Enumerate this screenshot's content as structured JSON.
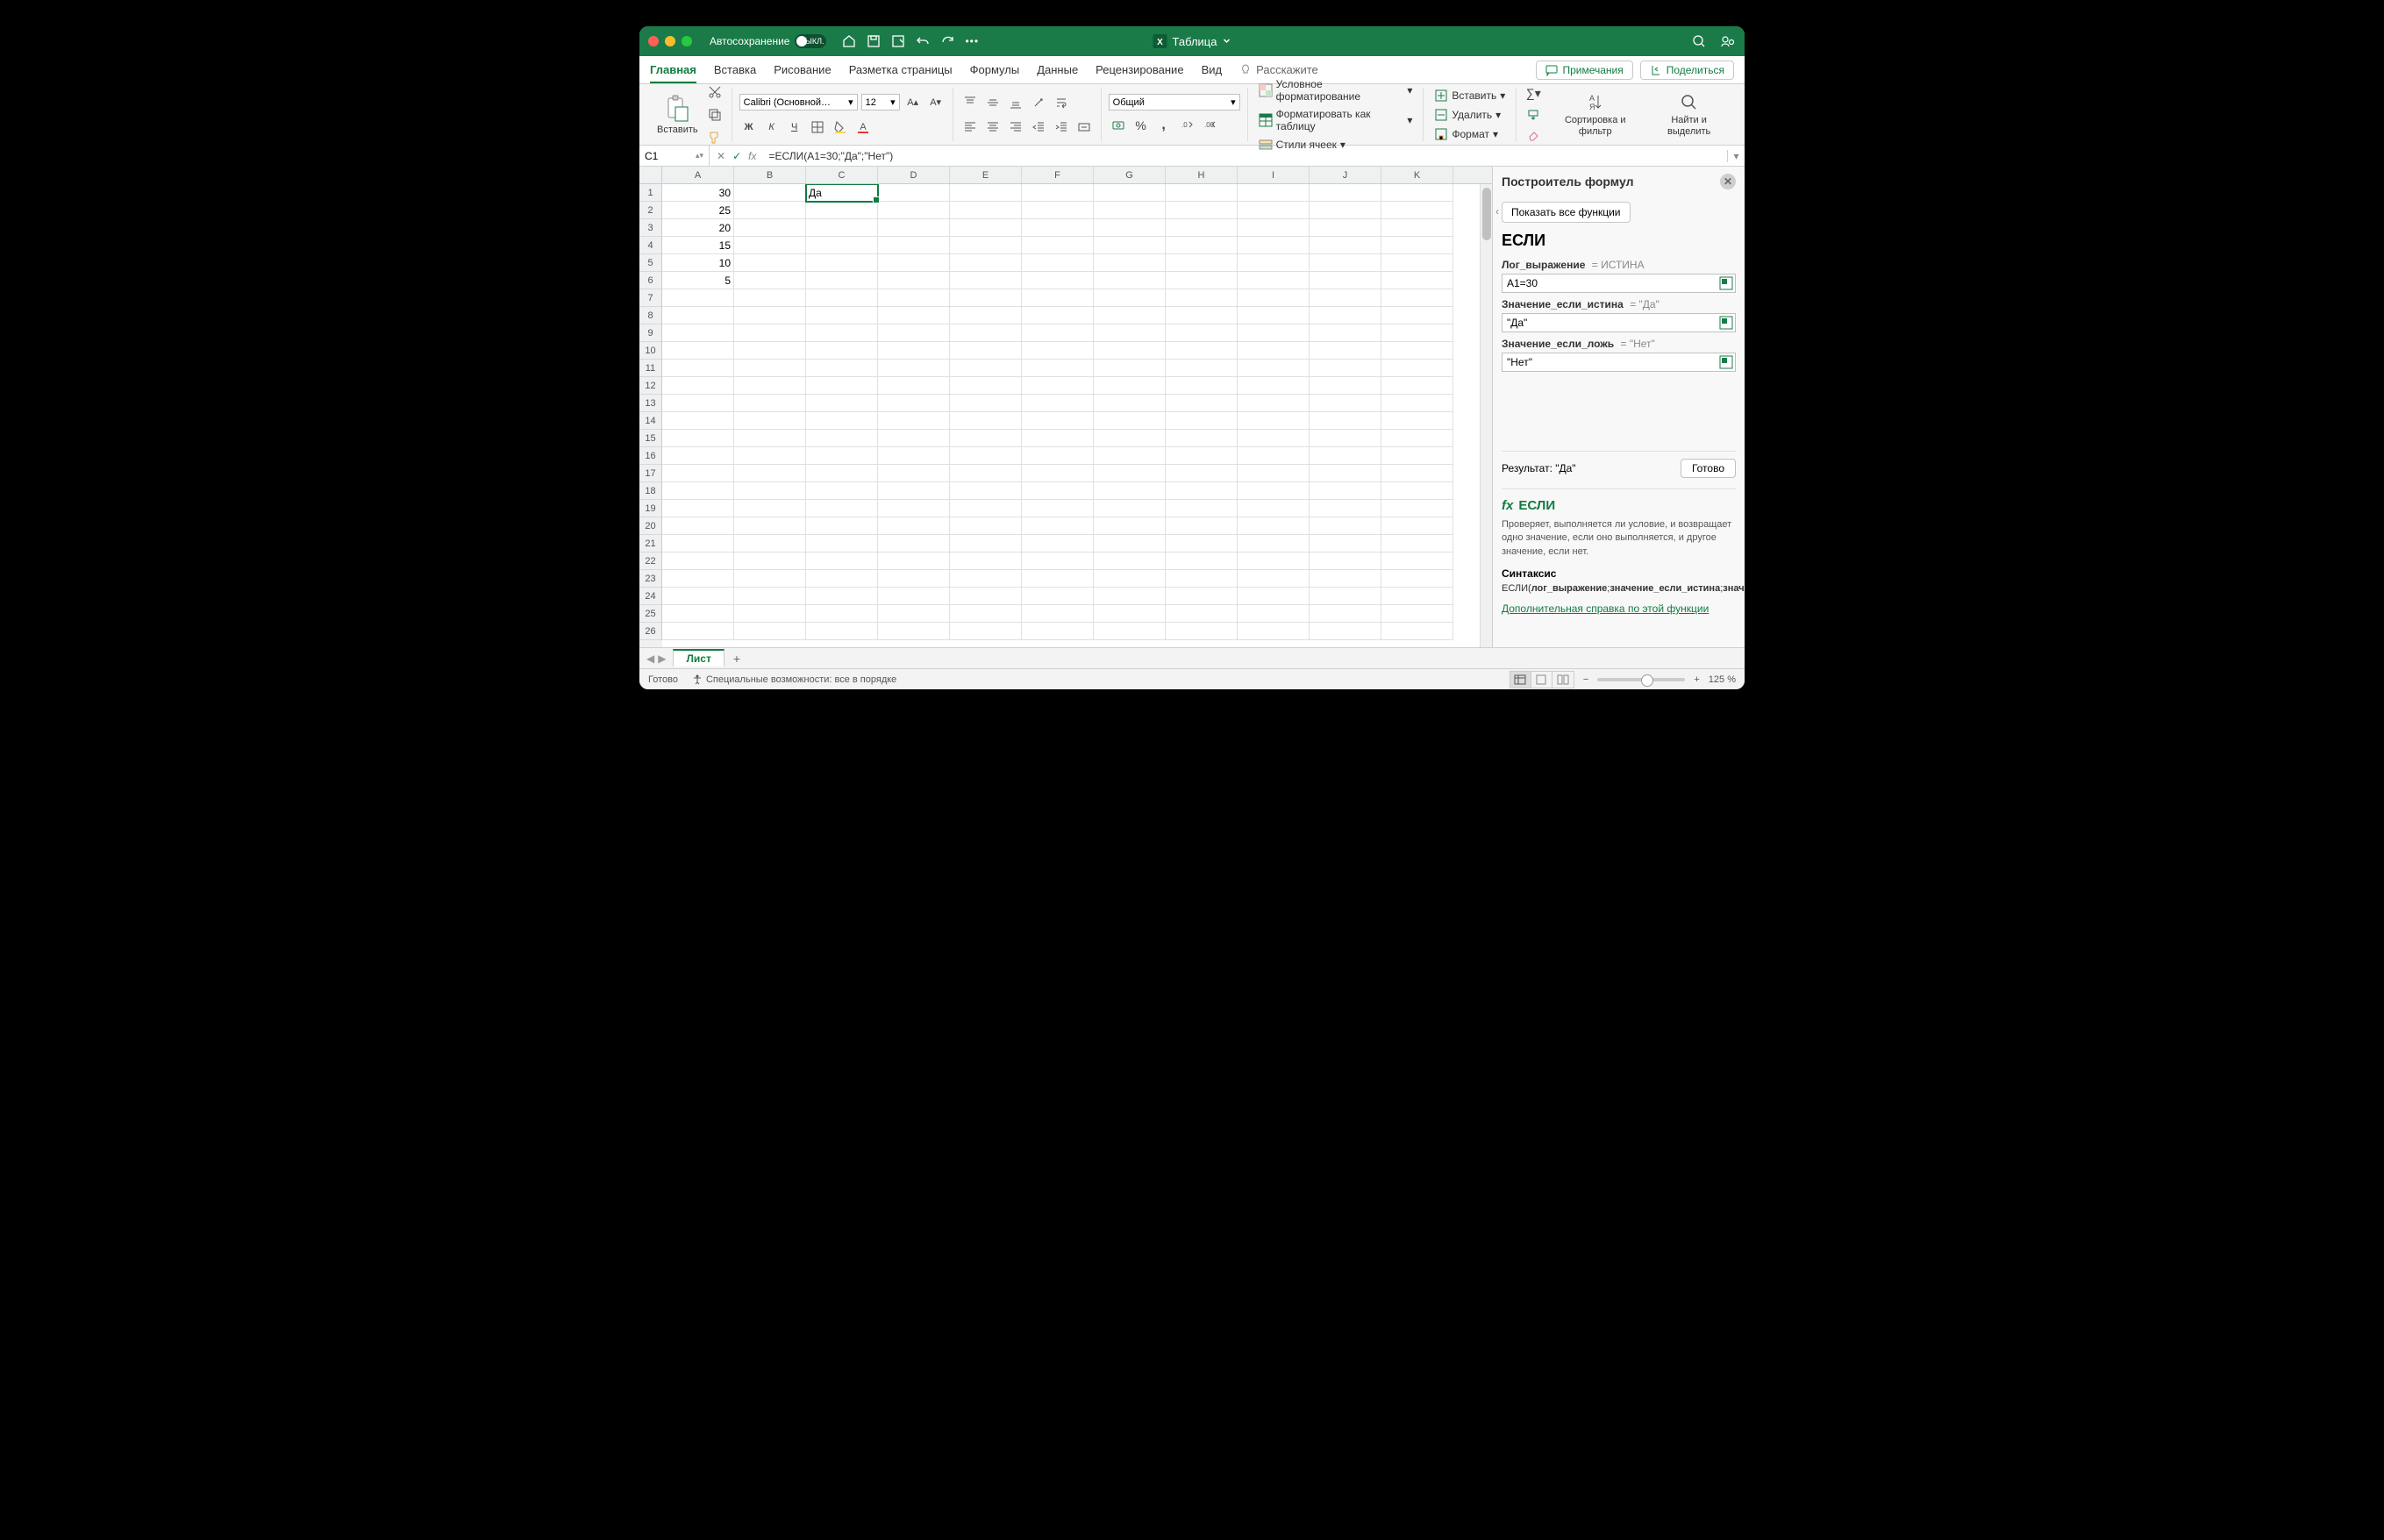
{
  "titlebar": {
    "autosave_label": "Автосохранение",
    "autosave_state": "ВЫКЛ.",
    "doc_title": "Таблица"
  },
  "tabs": {
    "home": "Главная",
    "insert": "Вставка",
    "draw": "Рисование",
    "layout": "Разметка страницы",
    "formulas": "Формулы",
    "data": "Данные",
    "review": "Рецензирование",
    "view": "Вид",
    "tellme": "Расскажите",
    "comments": "Примечания",
    "share": "Поделиться"
  },
  "ribbon": {
    "paste": "Вставить",
    "font_name": "Calibri (Основной…",
    "font_size": "12",
    "bold": "Ж",
    "italic": "К",
    "underline": "Ч",
    "number_format": "Общий",
    "cond_fmt": "Условное форматирование",
    "fmt_table": "Форматировать как таблицу",
    "cell_styles": "Стили ячеек",
    "insert_cells": "Вставить",
    "delete_cells": "Удалить",
    "format_cells": "Формат",
    "sort_filter": "Сортировка и фильтр",
    "find_select": "Найти и выделить"
  },
  "formula_bar": {
    "cell_ref": "C1",
    "formula": "=ЕСЛИ(A1=30;\"Да\";\"Нет\")"
  },
  "grid": {
    "columns": [
      "A",
      "B",
      "C",
      "D",
      "E",
      "F",
      "G",
      "H",
      "I",
      "J",
      "K"
    ],
    "rows": 26,
    "active_cell": {
      "col": 2,
      "row": 0
    },
    "data": {
      "A1": "30",
      "A2": "25",
      "A3": "20",
      "A4": "15",
      "A5": "10",
      "A6": "5",
      "C1": "Да"
    }
  },
  "panel": {
    "title": "Построитель формул",
    "show_all": "Показать все функции",
    "func_name": "ЕСЛИ",
    "arg1_label": "Лог_выражение",
    "arg1_result": "ИСТИНА",
    "arg1_value": "A1=30",
    "arg2_label": "Значение_если_истина",
    "arg2_result": "\"Да\"",
    "arg2_value": "\"Да\"",
    "arg3_label": "Значение_если_ложь",
    "arg3_result": "\"Нет\"",
    "arg3_value": "\"Нет\"",
    "result_label": "Результат: \"Да\"",
    "done": "Готово",
    "help_title": "ЕСЛИ",
    "help_desc": "Проверяет, выполняется ли условие, и возвращает одно значение, если оно выполняется, и другое значение, если нет.",
    "syntax_h": "Синтаксис",
    "syntax_t": "ЕСЛИ(лог_выражение;значение_если_истина;значение_если_ложь)",
    "help_link": "Дополнительная справка по этой функции"
  },
  "sheetbar": {
    "sheet1": "Лист"
  },
  "status": {
    "ready": "Готово",
    "accessibility": "Специальные возможности: все в порядке",
    "zoom": "125 %"
  }
}
